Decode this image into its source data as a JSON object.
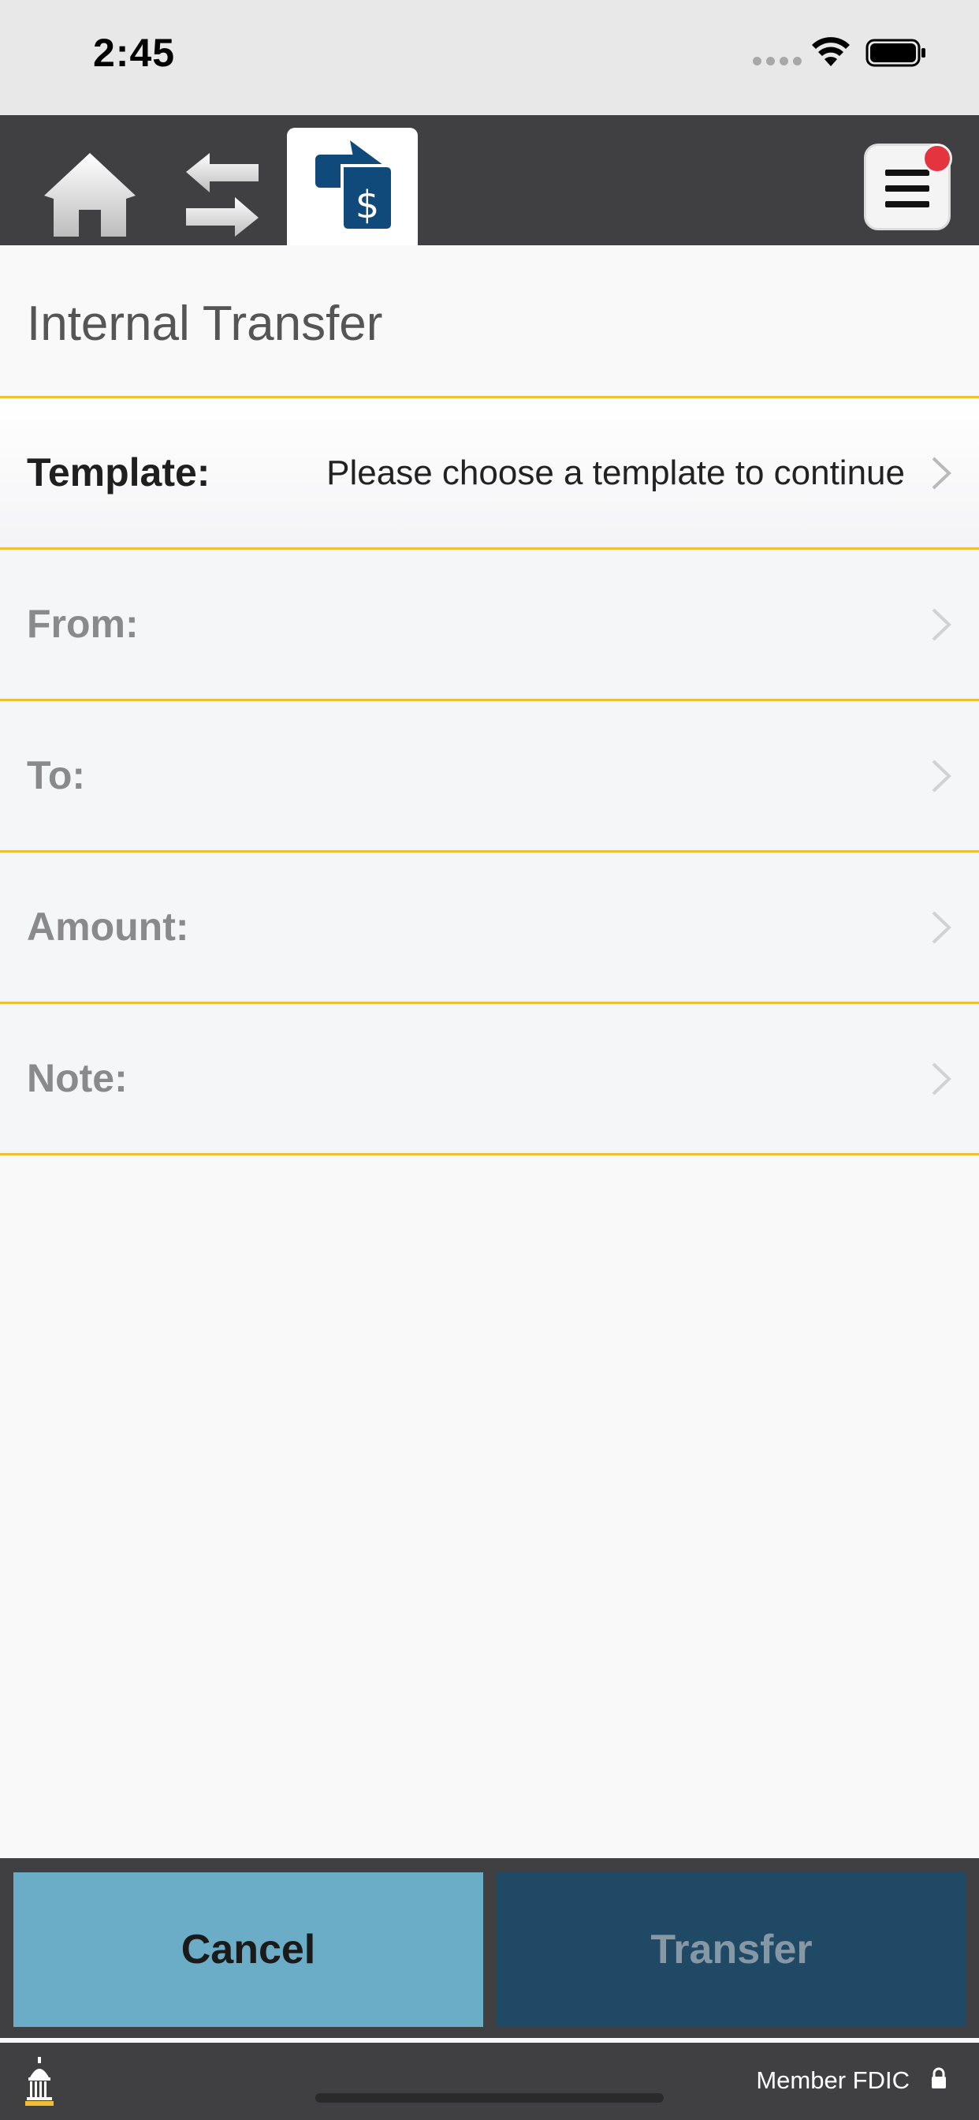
{
  "status_bar": {
    "time": "2:45"
  },
  "nav": {
    "items": [
      "home-icon",
      "swap-arrows-icon",
      "transfer-dollar-icon"
    ],
    "active": "transfer-dollar-icon",
    "menu_icon": "menu-icon",
    "has_notification": true
  },
  "page": {
    "title": "Internal Transfer"
  },
  "form": {
    "template": {
      "label": "Template:",
      "value": "Please choose a template to continue"
    },
    "from": {
      "label": "From:"
    },
    "to": {
      "label": "To:"
    },
    "amount": {
      "label": "Amount:"
    },
    "note": {
      "label": "Note:"
    }
  },
  "actions": {
    "cancel": "Cancel",
    "transfer": "Transfer"
  },
  "footer": {
    "text": "Member FDIC"
  },
  "colors": {
    "nav_bg": "#404042",
    "divider": "#f0bf33",
    "cancel_bg": "#6bacc7",
    "transfer_bg": "#1f4964",
    "accent_blue": "#0f4a7a",
    "notification": "#e4343f"
  }
}
